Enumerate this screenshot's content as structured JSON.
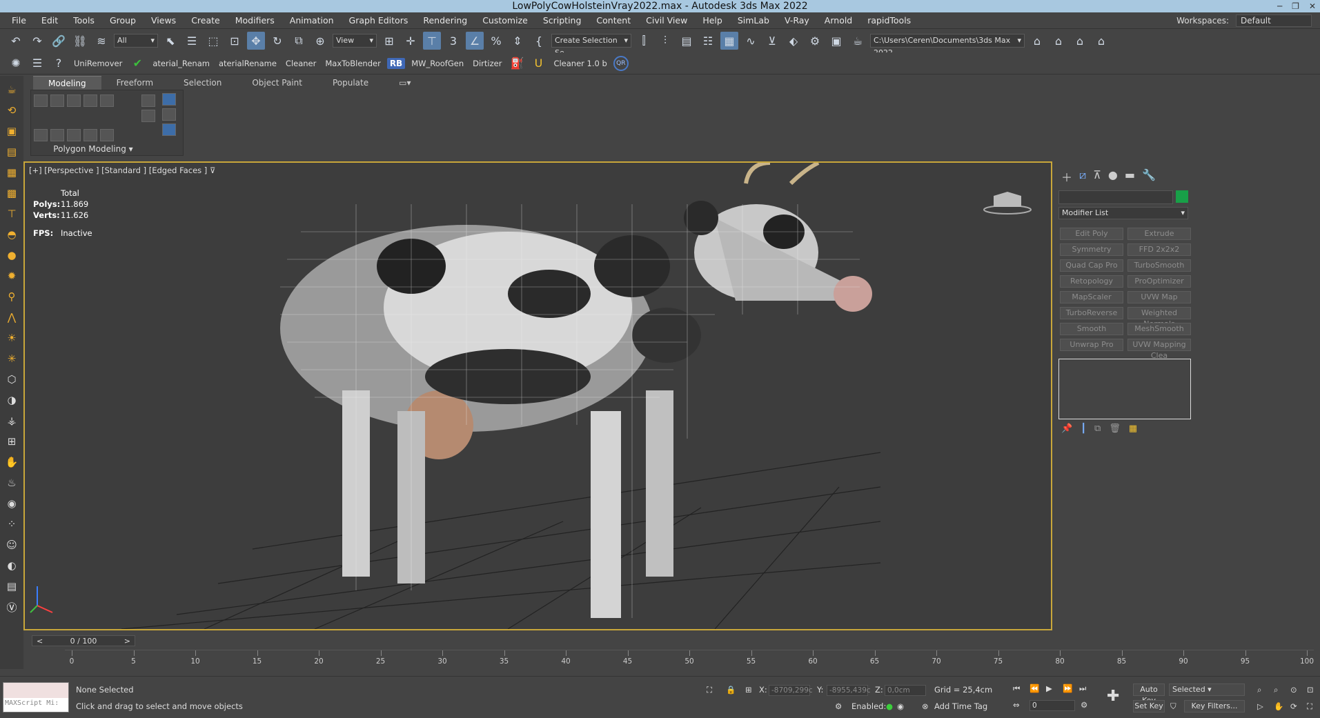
{
  "window": {
    "title": "LowPolyCowHolsteinVray2022.max - Autodesk 3ds Max 2022"
  },
  "menu": [
    "File",
    "Edit",
    "Tools",
    "Group",
    "Views",
    "Create",
    "Modifiers",
    "Animation",
    "Graph Editors",
    "Rendering",
    "Customize",
    "Scripting",
    "Content",
    "Civil View",
    "Help",
    "SimLab",
    "V-Ray",
    "Arnold",
    "rapidTools"
  ],
  "workspace": {
    "label": "Workspaces:",
    "value": "Default"
  },
  "toolbar1": {
    "filter": "All",
    "refcoord": "View",
    "selset": "Create Selection Se",
    "path": "C:\\Users\\Ceren\\Documents\\3ds Max 2022"
  },
  "toolbar2": {
    "labels": [
      "UniRemover",
      "aterial_Renam",
      "aterialRename",
      "Cleaner",
      "MaxToBlender",
      "MW_RoofGen",
      "Dirtizer",
      "Cleaner 1.0 b"
    ],
    "rb": "RB",
    "qr": "QR"
  },
  "ribbon": {
    "tabs": [
      "Modeling",
      "Freeform",
      "Selection",
      "Object Paint",
      "Populate"
    ],
    "label": "Polygon Modeling"
  },
  "viewport": {
    "label": "[+] [Perspective ] [Standard ] [Edged Faces ]",
    "stats_title": "Total",
    "polys_label": "Polys:",
    "polys": "11.869",
    "verts_label": "Verts:",
    "verts": "11.626",
    "fps_label": "FPS:",
    "fps": "Inactive"
  },
  "cmdpanel": {
    "modlist": "Modifier List",
    "buttons": [
      "Edit Poly",
      "Extrude",
      "Symmetry",
      "FFD 2x2x2",
      "Quad Cap Pro",
      "TurboSmooth",
      "Retopology",
      "ProOptimizer",
      "MapScaler",
      "UVW Map",
      "TurboReverse",
      "Weighted Normals",
      "Smooth",
      "MeshSmooth",
      "Unwrap Pro",
      "UVW Mapping Clea"
    ],
    "color": "#18a048"
  },
  "timeline": {
    "frame": "0 / 100",
    "ticks": [
      "0",
      "5",
      "10",
      "15",
      "20",
      "25",
      "30",
      "35",
      "40",
      "45",
      "50",
      "55",
      "60",
      "65",
      "70",
      "75",
      "80",
      "85",
      "90",
      "95",
      "100"
    ]
  },
  "status": {
    "selected": "None Selected",
    "hint": "Click and drag to select and move objects",
    "maxscript": "MAXScript Mi:",
    "x_label": "X:",
    "x": "-8709,299c",
    "y_label": "Y:",
    "y": "-8955,439c",
    "z_label": "Z:",
    "z": "0,0cm",
    "grid": "Grid = 25,4cm",
    "enabled": "Enabled:",
    "addtag": "Add Time Tag",
    "autokey": "Auto Key",
    "setkey": "Set Key",
    "selected_dd": "Selected",
    "keyfilters": "Key Filters...",
    "frame_field": "0"
  }
}
